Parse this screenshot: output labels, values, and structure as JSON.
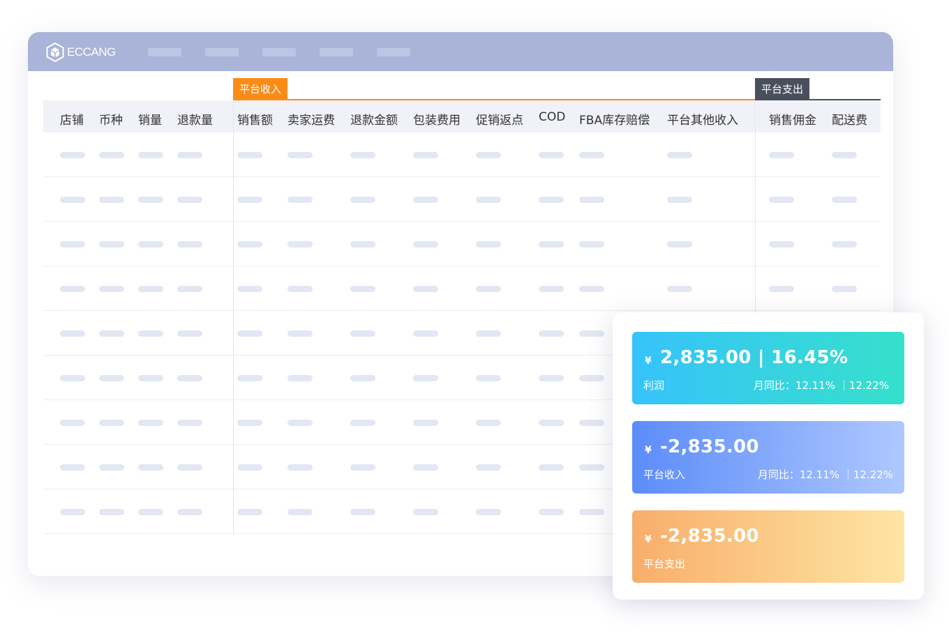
{
  "app": {
    "logo_text": "ECCANG"
  },
  "table": {
    "group_income": "平台收入",
    "group_expense": "平台支出",
    "columns": [
      "店铺",
      "币种",
      "销量",
      "退款量",
      "销售额",
      "卖家运费",
      "退款金额",
      "包装费用",
      "促销返点",
      "COD",
      "FBA库存赔偿",
      "平台其他收入",
      "销售佣金",
      "配送费"
    ]
  },
  "cards": [
    {
      "yen": "¥",
      "amount": "2,835.00 | 16.45%",
      "label": "利润",
      "comparison": "月同比：12.11% ｜12.22%"
    },
    {
      "yen": "¥",
      "amount": "-2,835.00",
      "label": "平台收入",
      "comparison": "月同比：12.11% ｜12.22%"
    },
    {
      "yen": "¥",
      "amount": "-2,835.00",
      "label": "平台支出"
    }
  ]
}
